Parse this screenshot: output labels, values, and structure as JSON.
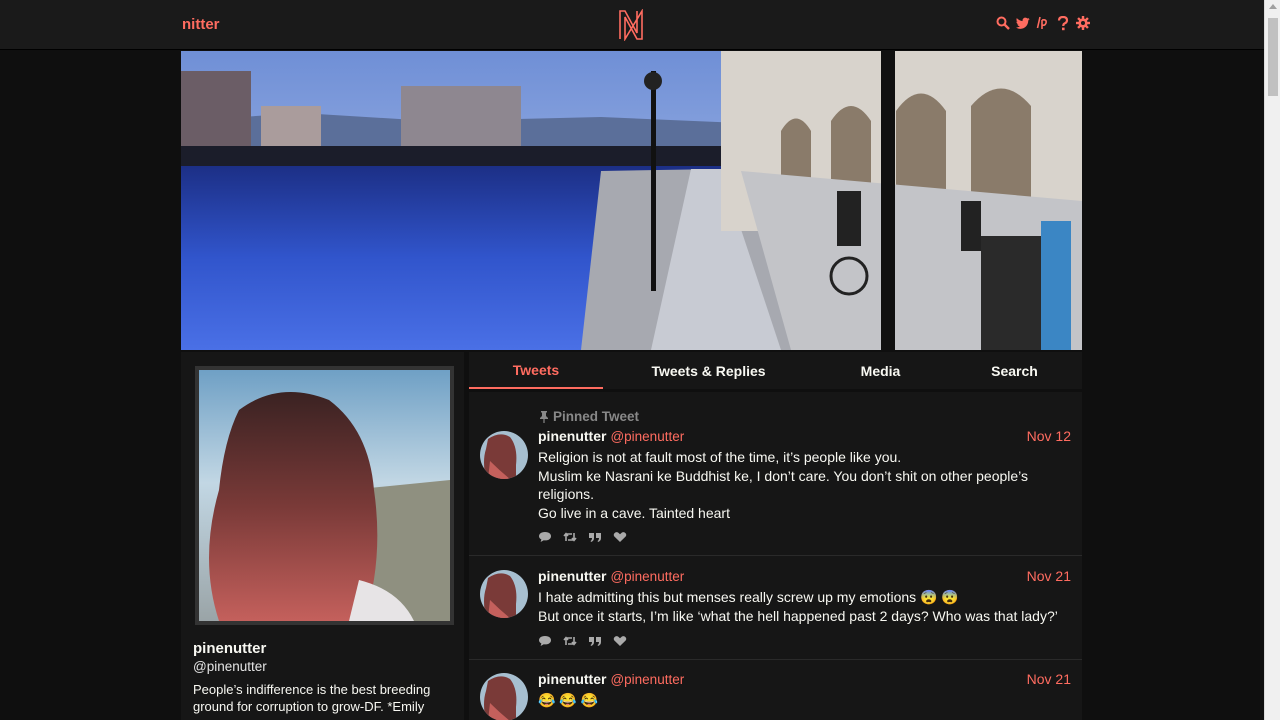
{
  "navbar": {
    "brand": "nitter",
    "logo_letter": "N",
    "icons": [
      "search-icon",
      "twitter-bird-icon",
      "lp-icon",
      "help-icon",
      "gear-icon"
    ],
    "accent": "#ff6c60"
  },
  "tabs": [
    {
      "label": "Tweets",
      "active": true
    },
    {
      "label": "Tweets & Replies",
      "active": false
    },
    {
      "label": "Media",
      "active": false
    },
    {
      "label": "Search",
      "active": false
    }
  ],
  "profile": {
    "fullname": "pinenutter",
    "username": "@pinenutter",
    "bio": "People’s indifference is the best breeding ground for corruption to grow-DF. *Emily"
  },
  "tweets": [
    {
      "pinned_label": "Pinned Tweet",
      "fullname": "pinenutter",
      "username": "@pinenutter",
      "date": "Nov 12",
      "lines": [
        "Religion is not at fault most of the time, it’s people like you.",
        "Muslim ke Nasrani ke Buddhist ke, I don’t care. You don’t shit on other people’s",
        "religions.",
        "Go live in a cave. Tainted heart"
      ]
    },
    {
      "fullname": "pinenutter",
      "username": "@pinenutter",
      "date": "Nov 21",
      "lines": [
        "I hate admitting this but menses really screw up my emotions 😨 😨",
        "But once it starts, I’m like ‘what the hell happened past 2 days? Who was that lady?’"
      ]
    },
    {
      "fullname": "pinenutter",
      "username": "@pinenutter",
      "date": "Nov 21",
      "lines": [
        "😂 😂 😂"
      ]
    }
  ]
}
